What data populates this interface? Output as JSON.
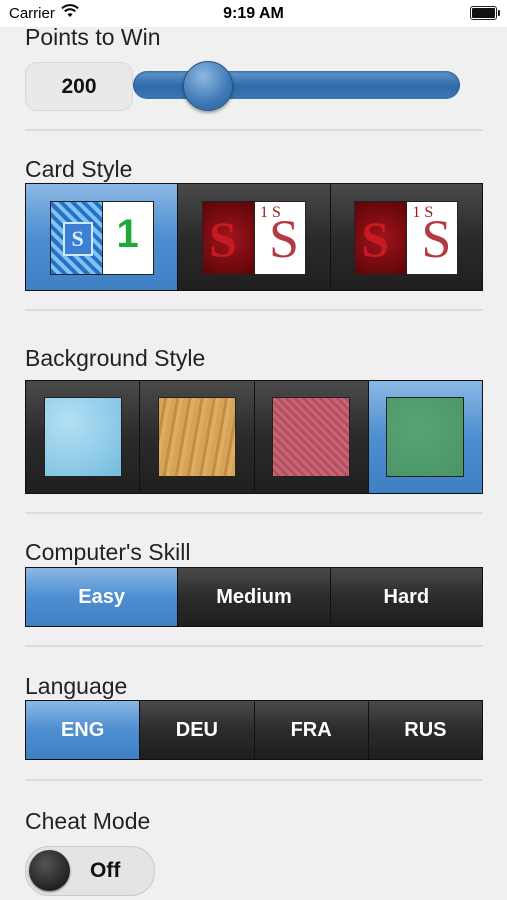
{
  "status_bar": {
    "carrier": "Carrier",
    "time": "9:19 AM"
  },
  "points": {
    "label": "Points to Win",
    "value": "200",
    "slider_fraction": 0.18
  },
  "card_style": {
    "label": "Card Style",
    "selected_index": 0,
    "options": [
      {
        "face": "1",
        "face_color": "#1fa83a",
        "back_color": "#2a6fc9"
      },
      {
        "face": "1 S",
        "face_color": "#9b1b1b",
        "back_color": "#7a0a0a"
      },
      {
        "face": "1 S",
        "face_color": "#9b1b1b",
        "back_color": "#7a0a0a"
      }
    ]
  },
  "background_style": {
    "label": "Background Style",
    "selected_index": 3,
    "options": [
      {
        "color": "#8ecbe8"
      },
      {
        "color": "#d09a4c"
      },
      {
        "color": "#c05a6a"
      },
      {
        "color": "#4f9a6b"
      }
    ]
  },
  "skill": {
    "label": "Computer's Skill",
    "selected_index": 0,
    "options": [
      "Easy",
      "Medium",
      "Hard"
    ]
  },
  "language": {
    "label": "Language",
    "selected_index": 0,
    "options": [
      "ENG",
      "DEU",
      "FRA",
      "RUS"
    ]
  },
  "cheat_mode": {
    "label": "Cheat Mode",
    "state": "Off"
  }
}
